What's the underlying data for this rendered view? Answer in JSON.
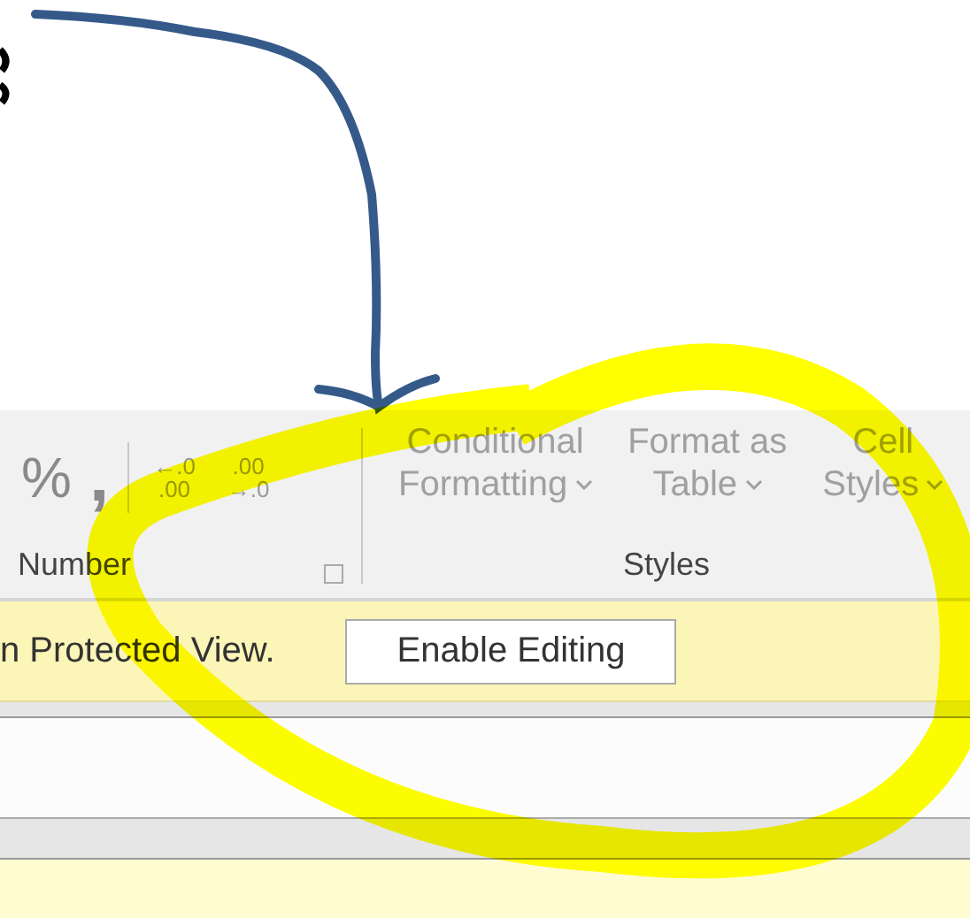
{
  "ribbon": {
    "number_group": {
      "label": "Number",
      "symbols": [
        "%",
        ","
      ],
      "decimal_buttons": [
        {
          "top": "←.0",
          "bottom": ".00"
        },
        {
          "top": ".00",
          "bottom": "→.0"
        }
      ]
    },
    "styles_group": {
      "label": "Styles",
      "buttons": [
        {
          "line1": "Conditional",
          "line2": "Formatting"
        },
        {
          "line1": "Format as",
          "line2": "Table"
        },
        {
          "line1": "Cell",
          "line2": "Styles"
        }
      ]
    }
  },
  "message_bar": {
    "text": "n Protected View.",
    "button": "Enable Editing"
  }
}
